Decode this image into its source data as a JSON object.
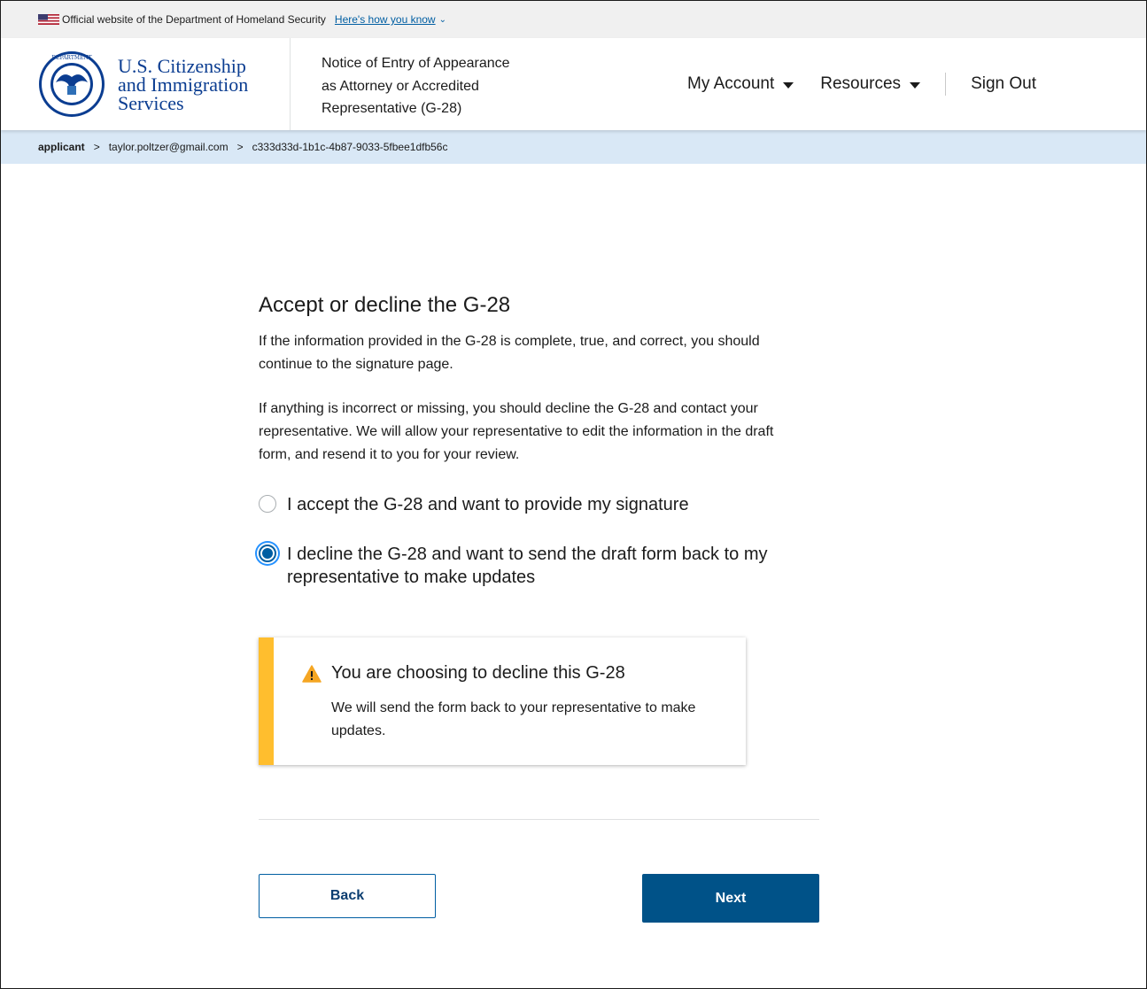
{
  "gov_banner": {
    "official_text": "Official website of the Department of Homeland Security",
    "how_you_know_link": "Here's how you know",
    "icons": [
      "us-flag-icon",
      "chevron-down-icon"
    ]
  },
  "header": {
    "agency_line1": "U.S. Citizenship",
    "agency_line2": "and Immigration",
    "agency_line3": "Services",
    "form_title_line1": "Notice of Entry of Appearance",
    "form_title_line2": "as Attorney or Accredited",
    "form_title_line3": "Representative (G-28)",
    "nav": {
      "my_account": "My Account",
      "resources": "Resources",
      "sign_out": "Sign Out"
    }
  },
  "breadcrumb": {
    "items": [
      "applicant",
      "taylor.poltzer@gmail.com",
      "c333d33d-1b1c-4b87-9033-5fbee1dfb56c"
    ],
    "separator": ">"
  },
  "main": {
    "heading": "Accept or decline the G-28",
    "paragraph1": "If the information provided in the G-28 is complete, true, and correct, you should continue to the signature page.",
    "paragraph2": "If anything is incorrect or missing, you should decline the G-28 and contact your representative. We will allow your representative to edit the information in the draft form, and resend it to you for your review.",
    "options": [
      {
        "label": "I accept the G-28 and want to provide my signature",
        "selected": false
      },
      {
        "label": "I decline the G-28 and want to send the draft form back to my representative to make updates",
        "selected": true
      }
    ],
    "alert": {
      "title": "You are choosing to decline this G-28",
      "body": "We will send the form back to your representative to make updates.",
      "accent_color": "#ffbe2e"
    },
    "buttons": {
      "back": "Back",
      "next": "Next"
    }
  },
  "colors": {
    "primary": "#005288",
    "link": "#005ea2",
    "breadcrumb_bg": "#d9e8f6",
    "banner_bg": "#f0f0f0",
    "agency_blue": "#0b3d91"
  }
}
